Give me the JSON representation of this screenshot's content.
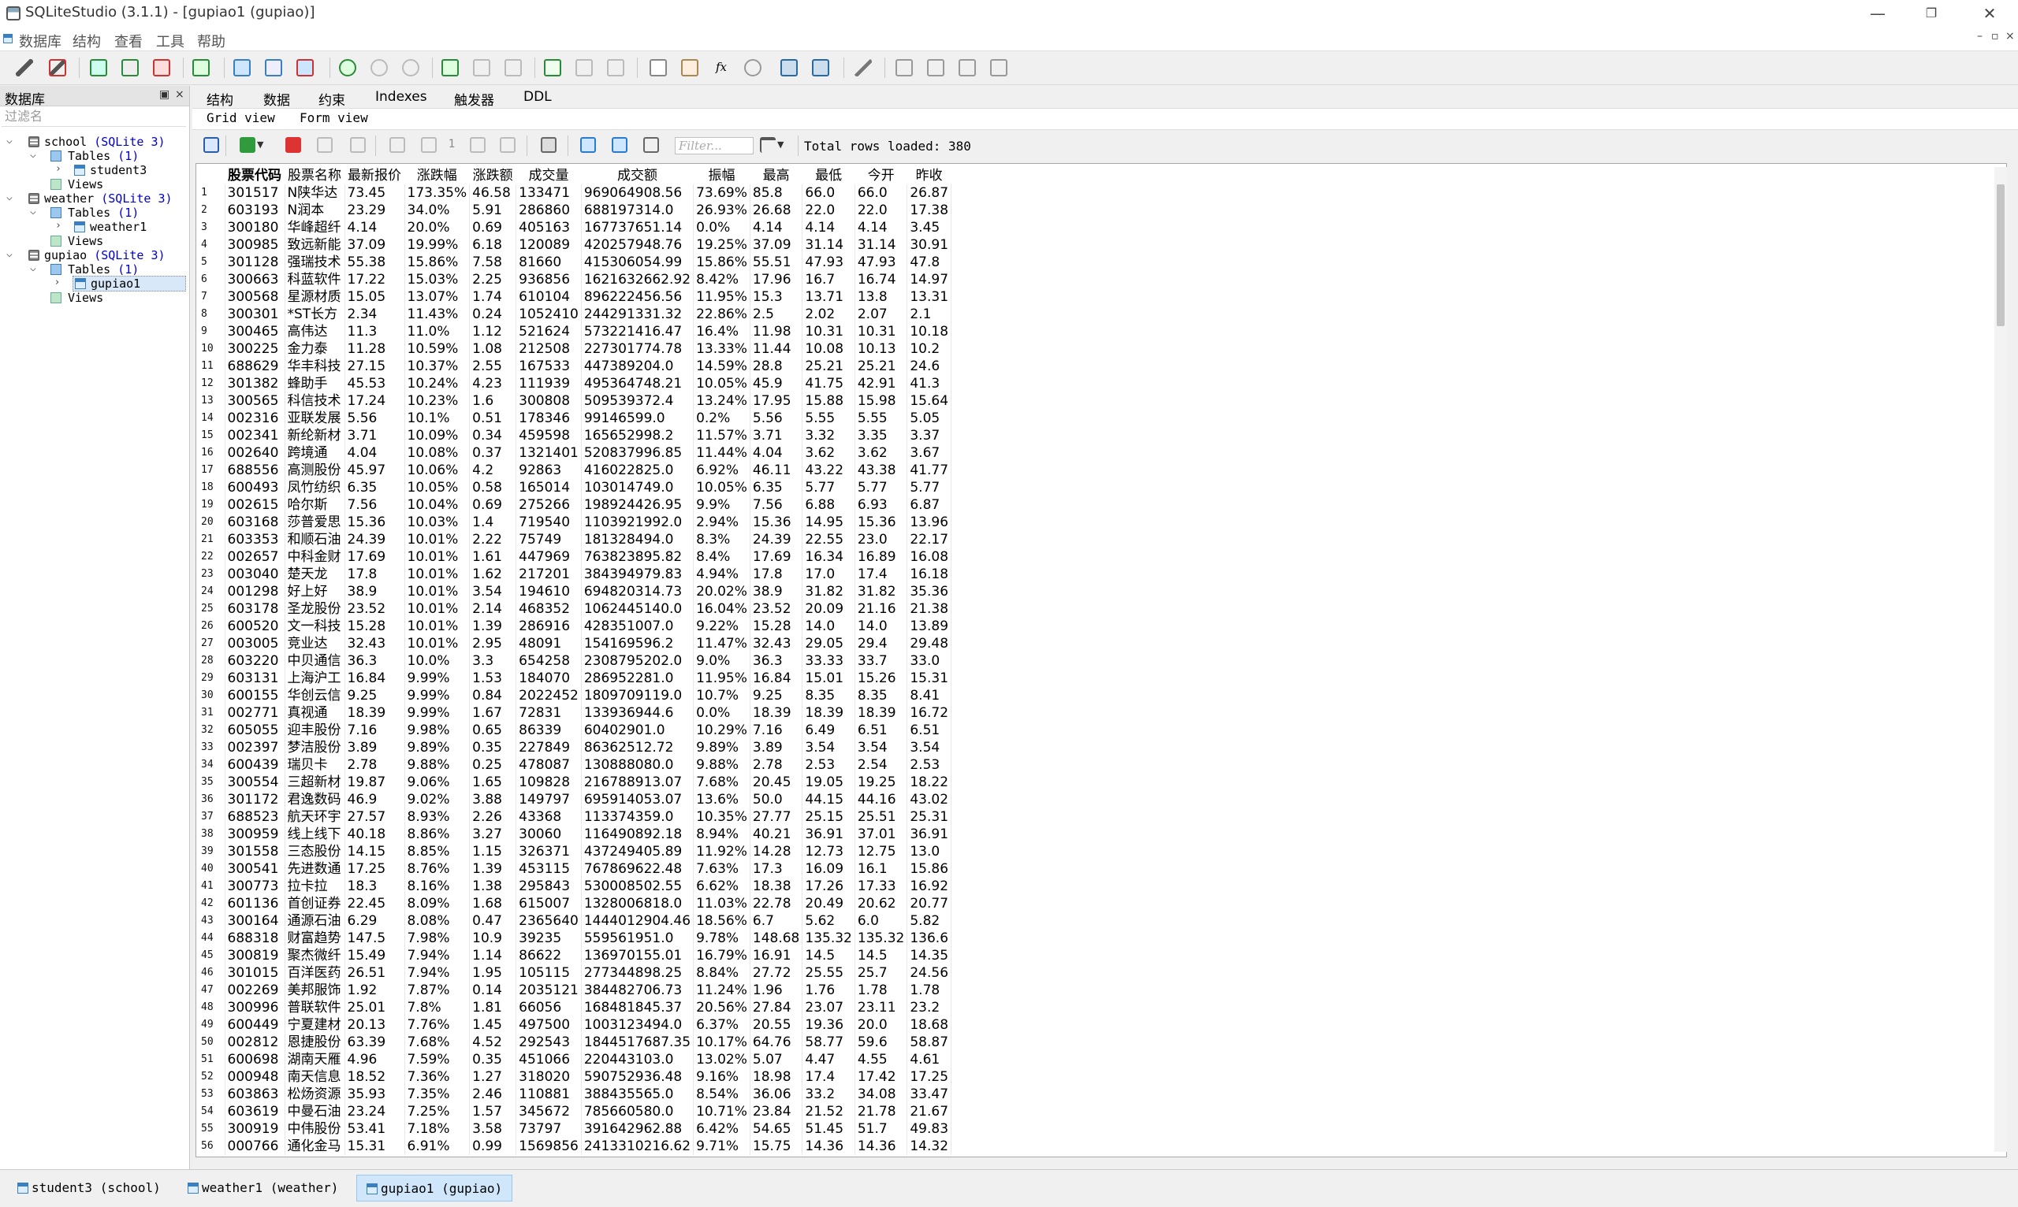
{
  "window": {
    "title": "SQLiteStudio (3.1.1) - [gupiao1 (gupiao)]",
    "minimize": "—",
    "maximize": "❐",
    "close": "✕"
  },
  "menu": [
    "数据库",
    "结构",
    "查看",
    "工具",
    "帮助"
  ],
  "mdi_controls": {
    "minimize": "–",
    "restore": "▫",
    "close": "×"
  },
  "db_panel": {
    "title": "数据库",
    "float_btn": "▣",
    "close_btn": "×",
    "filter_placeholder": "过滤名",
    "tree": [
      {
        "label": "school",
        "sub": "(SQLite 3)"
      },
      {
        "label": "Tables",
        "sub": "(1)"
      },
      {
        "label": "student3"
      },
      {
        "label": "Views"
      },
      {
        "label": "weather",
        "sub": "(SQLite 3)"
      },
      {
        "label": "Tables",
        "sub": "(1)"
      },
      {
        "label": "weather1"
      },
      {
        "label": "Views"
      },
      {
        "label": "gupiao",
        "sub": "(SQLite 3)"
      },
      {
        "label": "Tables",
        "sub": "(1)"
      },
      {
        "label": "gupiao1"
      },
      {
        "label": "Views"
      }
    ]
  },
  "editor_tabs": [
    "结构",
    "数据",
    "约束",
    "Indexes",
    "触发器",
    "DDL"
  ],
  "view_tabs": [
    "Grid view",
    "Form view"
  ],
  "grid_toolbar": {
    "page": "1",
    "filter_placeholder": "Filter...",
    "total_rows": "Total rows loaded: 380"
  },
  "grid": {
    "columns": [
      "股票代码",
      "股票名称",
      "最新报价",
      "涨跌幅",
      "涨跌额",
      "成交量",
      "成交额",
      "振幅",
      "最高",
      "最低",
      "今开",
      "昨收"
    ],
    "rows": [
      [
        "301517",
        "N陕华达",
        "73.45",
        "173.35%",
        "46.58",
        "133471",
        "969064908.56",
        "73.69%",
        "85.8",
        "66.0",
        "66.0",
        "26.87"
      ],
      [
        "603193",
        "N润本",
        "23.29",
        "34.0%",
        "5.91",
        "286860",
        "688197314.0",
        "26.93%",
        "26.68",
        "22.0",
        "22.0",
        "17.38"
      ],
      [
        "300180",
        "华峰超纤",
        "4.14",
        "20.0%",
        "0.69",
        "405163",
        "167737651.14",
        "0.0%",
        "4.14",
        "4.14",
        "4.14",
        "3.45"
      ],
      [
        "300985",
        "致远新能",
        "37.09",
        "19.99%",
        "6.18",
        "120089",
        "420257948.76",
        "19.25%",
        "37.09",
        "31.14",
        "31.14",
        "30.91"
      ],
      [
        "301128",
        "强瑞技术",
        "55.38",
        "15.86%",
        "7.58",
        "81660",
        "415306054.99",
        "15.86%",
        "55.51",
        "47.93",
        "47.93",
        "47.8"
      ],
      [
        "300663",
        "科蓝软件",
        "17.22",
        "15.03%",
        "2.25",
        "936856",
        "1621632662.92",
        "8.42%",
        "17.96",
        "16.7",
        "16.74",
        "14.97"
      ],
      [
        "300568",
        "星源材质",
        "15.05",
        "13.07%",
        "1.74",
        "610104",
        "896222456.56",
        "11.95%",
        "15.3",
        "13.71",
        "13.8",
        "13.31"
      ],
      [
        "300301",
        "*ST长方",
        "2.34",
        "11.43%",
        "0.24",
        "1052410",
        "244291331.32",
        "22.86%",
        "2.5",
        "2.02",
        "2.07",
        "2.1"
      ],
      [
        "300465",
        "高伟达",
        "11.3",
        "11.0%",
        "1.12",
        "521624",
        "573221416.47",
        "16.4%",
        "11.98",
        "10.31",
        "10.31",
        "10.18"
      ],
      [
        "300225",
        "金力泰",
        "11.28",
        "10.59%",
        "1.08",
        "212508",
        "227301774.78",
        "13.33%",
        "11.44",
        "10.08",
        "10.13",
        "10.2"
      ],
      [
        "688629",
        "华丰科技",
        "27.15",
        "10.37%",
        "2.55",
        "167533",
        "447389204.0",
        "14.59%",
        "28.8",
        "25.21",
        "25.21",
        "24.6"
      ],
      [
        "301382",
        "蜂助手",
        "45.53",
        "10.24%",
        "4.23",
        "111939",
        "495364748.21",
        "10.05%",
        "45.9",
        "41.75",
        "42.91",
        "41.3"
      ],
      [
        "300565",
        "科信技术",
        "17.24",
        "10.23%",
        "1.6",
        "300808",
        "509539372.4",
        "13.24%",
        "17.95",
        "15.88",
        "15.98",
        "15.64"
      ],
      [
        "002316",
        "亚联发展",
        "5.56",
        "10.1%",
        "0.51",
        "178346",
        "99146599.0",
        "0.2%",
        "5.56",
        "5.55",
        "5.55",
        "5.05"
      ],
      [
        "002341",
        "新纶新材",
        "3.71",
        "10.09%",
        "0.34",
        "459598",
        "165652998.2",
        "11.57%",
        "3.71",
        "3.32",
        "3.35",
        "3.37"
      ],
      [
        "002640",
        "跨境通",
        "4.04",
        "10.08%",
        "0.37",
        "1321401",
        "520837996.85",
        "11.44%",
        "4.04",
        "3.62",
        "3.62",
        "3.67"
      ],
      [
        "688556",
        "高测股份",
        "45.97",
        "10.06%",
        "4.2",
        "92863",
        "416022825.0",
        "6.92%",
        "46.11",
        "43.22",
        "43.38",
        "41.77"
      ],
      [
        "600493",
        "凤竹纺织",
        "6.35",
        "10.05%",
        "0.58",
        "165014",
        "103014749.0",
        "10.05%",
        "6.35",
        "5.77",
        "5.77",
        "5.77"
      ],
      [
        "002615",
        "哈尔斯",
        "7.56",
        "10.04%",
        "0.69",
        "275266",
        "198924426.95",
        "9.9%",
        "7.56",
        "6.88",
        "6.93",
        "6.87"
      ],
      [
        "603168",
        "莎普爱思",
        "15.36",
        "10.03%",
        "1.4",
        "719540",
        "1103921992.0",
        "2.94%",
        "15.36",
        "14.95",
        "15.36",
        "13.96"
      ],
      [
        "603353",
        "和顺石油",
        "24.39",
        "10.01%",
        "2.22",
        "75749",
        "181328494.0",
        "8.3%",
        "24.39",
        "22.55",
        "23.0",
        "22.17"
      ],
      [
        "002657",
        "中科金财",
        "17.69",
        "10.01%",
        "1.61",
        "447969",
        "763823895.82",
        "8.4%",
        "17.69",
        "16.34",
        "16.89",
        "16.08"
      ],
      [
        "003040",
        "楚天龙",
        "17.8",
        "10.01%",
        "1.62",
        "217201",
        "384394979.83",
        "4.94%",
        "17.8",
        "17.0",
        "17.4",
        "16.18"
      ],
      [
        "001298",
        "好上好",
        "38.9",
        "10.01%",
        "3.54",
        "194610",
        "694820314.73",
        "20.02%",
        "38.9",
        "31.82",
        "31.82",
        "35.36"
      ],
      [
        "603178",
        "圣龙股份",
        "23.52",
        "10.01%",
        "2.14",
        "468352",
        "1062445140.0",
        "16.04%",
        "23.52",
        "20.09",
        "21.16",
        "21.38"
      ],
      [
        "600520",
        "文一科技",
        "15.28",
        "10.01%",
        "1.39",
        "286916",
        "428351007.0",
        "9.22%",
        "15.28",
        "14.0",
        "14.0",
        "13.89"
      ],
      [
        "003005",
        "竞业达",
        "32.43",
        "10.01%",
        "2.95",
        "48091",
        "154169596.2",
        "11.47%",
        "32.43",
        "29.05",
        "29.4",
        "29.48"
      ],
      [
        "603220",
        "中贝通信",
        "36.3",
        "10.0%",
        "3.3",
        "654258",
        "2308795202.0",
        "9.0%",
        "36.3",
        "33.33",
        "33.7",
        "33.0"
      ],
      [
        "603131",
        "上海沪工",
        "16.84",
        "9.99%",
        "1.53",
        "184070",
        "286952281.0",
        "11.95%",
        "16.84",
        "15.01",
        "15.26",
        "15.31"
      ],
      [
        "600155",
        "华创云信",
        "9.25",
        "9.99%",
        "0.84",
        "2022452",
        "1809709119.0",
        "10.7%",
        "9.25",
        "8.35",
        "8.35",
        "8.41"
      ],
      [
        "002771",
        "真视通",
        "18.39",
        "9.99%",
        "1.67",
        "72831",
        "133936944.6",
        "0.0%",
        "18.39",
        "18.39",
        "18.39",
        "16.72"
      ],
      [
        "605055",
        "迎丰股份",
        "7.16",
        "9.98%",
        "0.65",
        "86339",
        "60402901.0",
        "10.29%",
        "7.16",
        "6.49",
        "6.51",
        "6.51"
      ],
      [
        "002397",
        "梦洁股份",
        "3.89",
        "9.89%",
        "0.35",
        "227849",
        "86362512.72",
        "9.89%",
        "3.89",
        "3.54",
        "3.54",
        "3.54"
      ],
      [
        "600439",
        "瑞贝卡",
        "2.78",
        "9.88%",
        "0.25",
        "478087",
        "130888080.0",
        "9.88%",
        "2.78",
        "2.53",
        "2.54",
        "2.53"
      ],
      [
        "300554",
        "三超新材",
        "19.87",
        "9.06%",
        "1.65",
        "109828",
        "216788913.07",
        "7.68%",
        "20.45",
        "19.05",
        "19.25",
        "18.22"
      ],
      [
        "301172",
        "君逸数码",
        "46.9",
        "9.02%",
        "3.88",
        "149797",
        "695914053.07",
        "13.6%",
        "50.0",
        "44.15",
        "44.16",
        "43.02"
      ],
      [
        "688523",
        "航天环宇",
        "27.57",
        "8.93%",
        "2.26",
        "43368",
        "113374359.0",
        "10.35%",
        "27.77",
        "25.15",
        "25.51",
        "25.31"
      ],
      [
        "300959",
        "线上线下",
        "40.18",
        "8.86%",
        "3.27",
        "30060",
        "116490892.18",
        "8.94%",
        "40.21",
        "36.91",
        "37.01",
        "36.91"
      ],
      [
        "301558",
        "三态股份",
        "14.15",
        "8.85%",
        "1.15",
        "326371",
        "437249405.89",
        "11.92%",
        "14.28",
        "12.73",
        "12.75",
        "13.0"
      ],
      [
        "300541",
        "先进数通",
        "17.25",
        "8.76%",
        "1.39",
        "453115",
        "767869622.48",
        "7.63%",
        "17.3",
        "16.09",
        "16.1",
        "15.86"
      ],
      [
        "300773",
        "拉卡拉",
        "18.3",
        "8.16%",
        "1.38",
        "295843",
        "530008502.55",
        "6.62%",
        "18.38",
        "17.26",
        "17.33",
        "16.92"
      ],
      [
        "601136",
        "首创证券",
        "22.45",
        "8.09%",
        "1.68",
        "615007",
        "1328006818.0",
        "11.03%",
        "22.78",
        "20.49",
        "20.62",
        "20.77"
      ],
      [
        "300164",
        "通源石油",
        "6.29",
        "8.08%",
        "0.47",
        "2365640",
        "1444012904.46",
        "18.56%",
        "6.7",
        "5.62",
        "6.0",
        "5.82"
      ],
      [
        "688318",
        "财富趋势",
        "147.5",
        "7.98%",
        "10.9",
        "39235",
        "559561951.0",
        "9.78%",
        "148.68",
        "135.32",
        "135.32",
        "136.6"
      ],
      [
        "300819",
        "聚杰微纤",
        "15.49",
        "7.94%",
        "1.14",
        "86622",
        "136970155.01",
        "16.79%",
        "16.91",
        "14.5",
        "14.5",
        "14.35"
      ],
      [
        "301015",
        "百洋医药",
        "26.51",
        "7.94%",
        "1.95",
        "105115",
        "277344898.25",
        "8.84%",
        "27.72",
        "25.55",
        "25.7",
        "24.56"
      ],
      [
        "002269",
        "美邦服饰",
        "1.92",
        "7.87%",
        "0.14",
        "2035121",
        "384482706.73",
        "11.24%",
        "1.96",
        "1.76",
        "1.78",
        "1.78"
      ],
      [
        "300996",
        "普联软件",
        "25.01",
        "7.8%",
        "1.81",
        "66056",
        "168481845.37",
        "20.56%",
        "27.84",
        "23.07",
        "23.11",
        "23.2"
      ],
      [
        "600449",
        "宁夏建材",
        "20.13",
        "7.76%",
        "1.45",
        "497500",
        "1003123494.0",
        "6.37%",
        "20.55",
        "19.36",
        "20.0",
        "18.68"
      ],
      [
        "002812",
        "恩捷股份",
        "63.39",
        "7.68%",
        "4.52",
        "292543",
        "1844517687.35",
        "10.17%",
        "64.76",
        "58.77",
        "59.6",
        "58.87"
      ],
      [
        "600698",
        "湖南天雁",
        "4.96",
        "7.59%",
        "0.35",
        "451066",
        "220443103.0",
        "13.02%",
        "5.07",
        "4.47",
        "4.55",
        "4.61"
      ],
      [
        "000948",
        "南天信息",
        "18.52",
        "7.36%",
        "1.27",
        "318020",
        "590752936.48",
        "9.16%",
        "18.98",
        "17.4",
        "17.42",
        "17.25"
      ],
      [
        "603863",
        "松炀资源",
        "35.93",
        "7.35%",
        "2.46",
        "110881",
        "388435565.0",
        "8.54%",
        "36.06",
        "33.2",
        "34.08",
        "33.47"
      ],
      [
        "603619",
        "中曼石油",
        "23.24",
        "7.25%",
        "1.57",
        "345672",
        "785660580.0",
        "10.71%",
        "23.84",
        "21.52",
        "21.78",
        "21.67"
      ],
      [
        "300919",
        "中伟股份",
        "53.41",
        "7.18%",
        "3.58",
        "73797",
        "391642962.88",
        "6.42%",
        "54.65",
        "51.45",
        "51.7",
        "49.83"
      ],
      [
        "000766",
        "通化金马",
        "15.31",
        "6.91%",
        "0.99",
        "1569856",
        "2413310216.62",
        "9.71%",
        "15.75",
        "14.36",
        "14.36",
        "14.32"
      ]
    ]
  },
  "window_tabs": [
    "student3 (school)",
    "weather1 (weather)",
    "gupiao1 (gupiao)"
  ],
  "colors": {
    "accent": "#0000cc",
    "active_tab": "#cfe6fb",
    "selection": "#d8e8f8"
  }
}
